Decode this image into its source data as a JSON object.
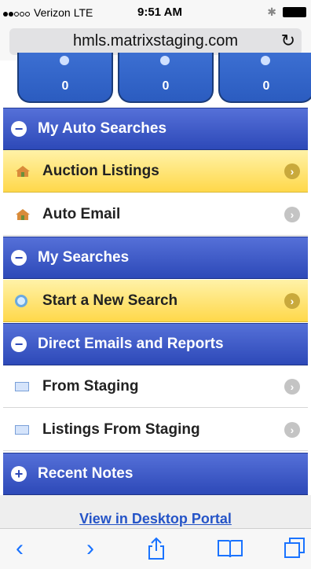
{
  "status_bar": {
    "carrier": "Verizon",
    "network": "LTE",
    "time": "9:51 AM",
    "bluetooth_icon": "bluetooth-icon",
    "battery_icon": "battery-icon"
  },
  "browser": {
    "url": "hmls.matrixstaging.com",
    "reload_icon": "reload-icon"
  },
  "tiles": [
    {
      "count": "0"
    },
    {
      "count": "0"
    },
    {
      "count": "0"
    }
  ],
  "sections": {
    "auto_searches": "My Auto Searches",
    "auction_listings": "Auction Listings",
    "auto_email": "Auto Email",
    "my_searches": "My Searches",
    "start_search": "Start a New Search",
    "direct_emails": "Direct Emails and Reports",
    "from_staging": "From Staging",
    "listings_from_staging": "Listings From Staging",
    "recent_notes": "Recent Notes"
  },
  "header_toggles": {
    "auto_searches": "−",
    "my_searches": "−",
    "direct_emails": "−",
    "recent_notes": "+"
  },
  "footer": {
    "desktop_link": "View in Desktop Portal"
  },
  "colors": {
    "header_blue": "#2d49b8",
    "highlight_yellow": "#ffd84a",
    "link_blue": "#2554c7",
    "ios_blue": "#1a73ff"
  }
}
